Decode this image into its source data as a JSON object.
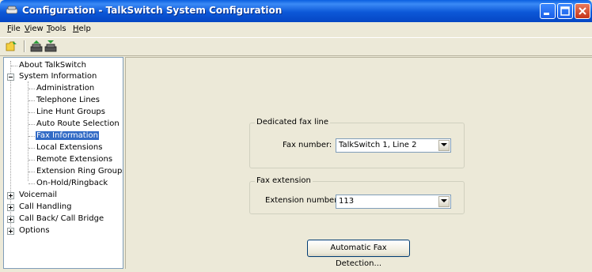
{
  "window": {
    "title": "Configuration - TalkSwitch System Configuration"
  },
  "menubar": {
    "items": [
      {
        "first": "F",
        "rest": "ile"
      },
      {
        "first": "V",
        "rest": "iew"
      },
      {
        "first": "T",
        "rest": "ools"
      },
      {
        "first": "H",
        "rest": "elp"
      }
    ]
  },
  "toolbar": {
    "icons": [
      "open-icon",
      "upload-config-icon",
      "download-config-icon"
    ]
  },
  "tree": {
    "items": [
      {
        "label": "About TalkSwitch"
      },
      {
        "label": "System Information"
      },
      {
        "label": "Administration"
      },
      {
        "label": "Telephone Lines"
      },
      {
        "label": "Line Hunt Groups"
      },
      {
        "label": "Auto Route Selection"
      },
      {
        "label": "Fax Information",
        "selected": true
      },
      {
        "label": "Local Extensions"
      },
      {
        "label": "Remote Extensions"
      },
      {
        "label": "Extension Ring Groups"
      },
      {
        "label": "On-Hold/Ringback"
      },
      {
        "label": "Voicemail"
      },
      {
        "label": "Call Handling"
      },
      {
        "label": "Call Back/ Call Bridge"
      },
      {
        "label": "Options"
      }
    ]
  },
  "content": {
    "dedicated_group": {
      "title": "Dedicated fax line",
      "label": "Fax number:",
      "value": "TalkSwitch 1, Line 2"
    },
    "extension_group": {
      "title": "Fax extension",
      "label": "Extension number:",
      "value": "113"
    },
    "auto_detect_button": "Automatic Fax Detection..."
  },
  "colors": {
    "titlebar": "#0a5fe0",
    "selection": "#316ac5",
    "panel": "#ece9d8"
  }
}
